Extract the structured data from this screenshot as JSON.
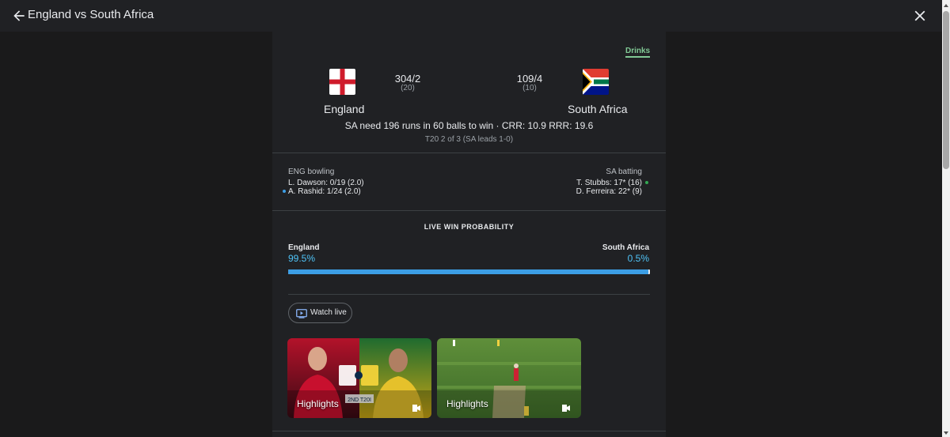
{
  "header": {
    "title": "England vs South Africa"
  },
  "status_tag": "Drinks",
  "home": {
    "name": "England",
    "score": "304/2",
    "overs": "(20)"
  },
  "away": {
    "name": "South Africa",
    "score": "109/4",
    "overs": "(10)"
  },
  "match_status": "SA need 196 runs in 60 balls to win · CRR: 10.9 RRR: 19.6",
  "series": "T20 2 of 3 (SA leads 1-0)",
  "bowling": {
    "heading": "ENG bowling",
    "players": [
      "L. Dawson: 0/19 (2.0)",
      "A. Rashid: 1/24 (2.0)"
    ]
  },
  "batting": {
    "heading": "SA batting",
    "players": [
      "T. Stubbs: 17* (16)",
      "D. Ferreira: 22* (9)"
    ]
  },
  "win_probability": {
    "title": "LIVE WIN PROBABILITY",
    "home_team": "England",
    "home_pct": "99.5%",
    "home_value": 99.5,
    "away_team": "South Africa",
    "away_pct": "0.5%",
    "away_value": 0.5
  },
  "watch_live": "Watch live",
  "videos": [
    {
      "caption": "Highlights",
      "thumbnail_text": "2ND T20I"
    },
    {
      "caption": "Highlights"
    }
  ],
  "colors": {
    "accent_green": "#81c995",
    "probability_blue": "#3c9ee5"
  }
}
